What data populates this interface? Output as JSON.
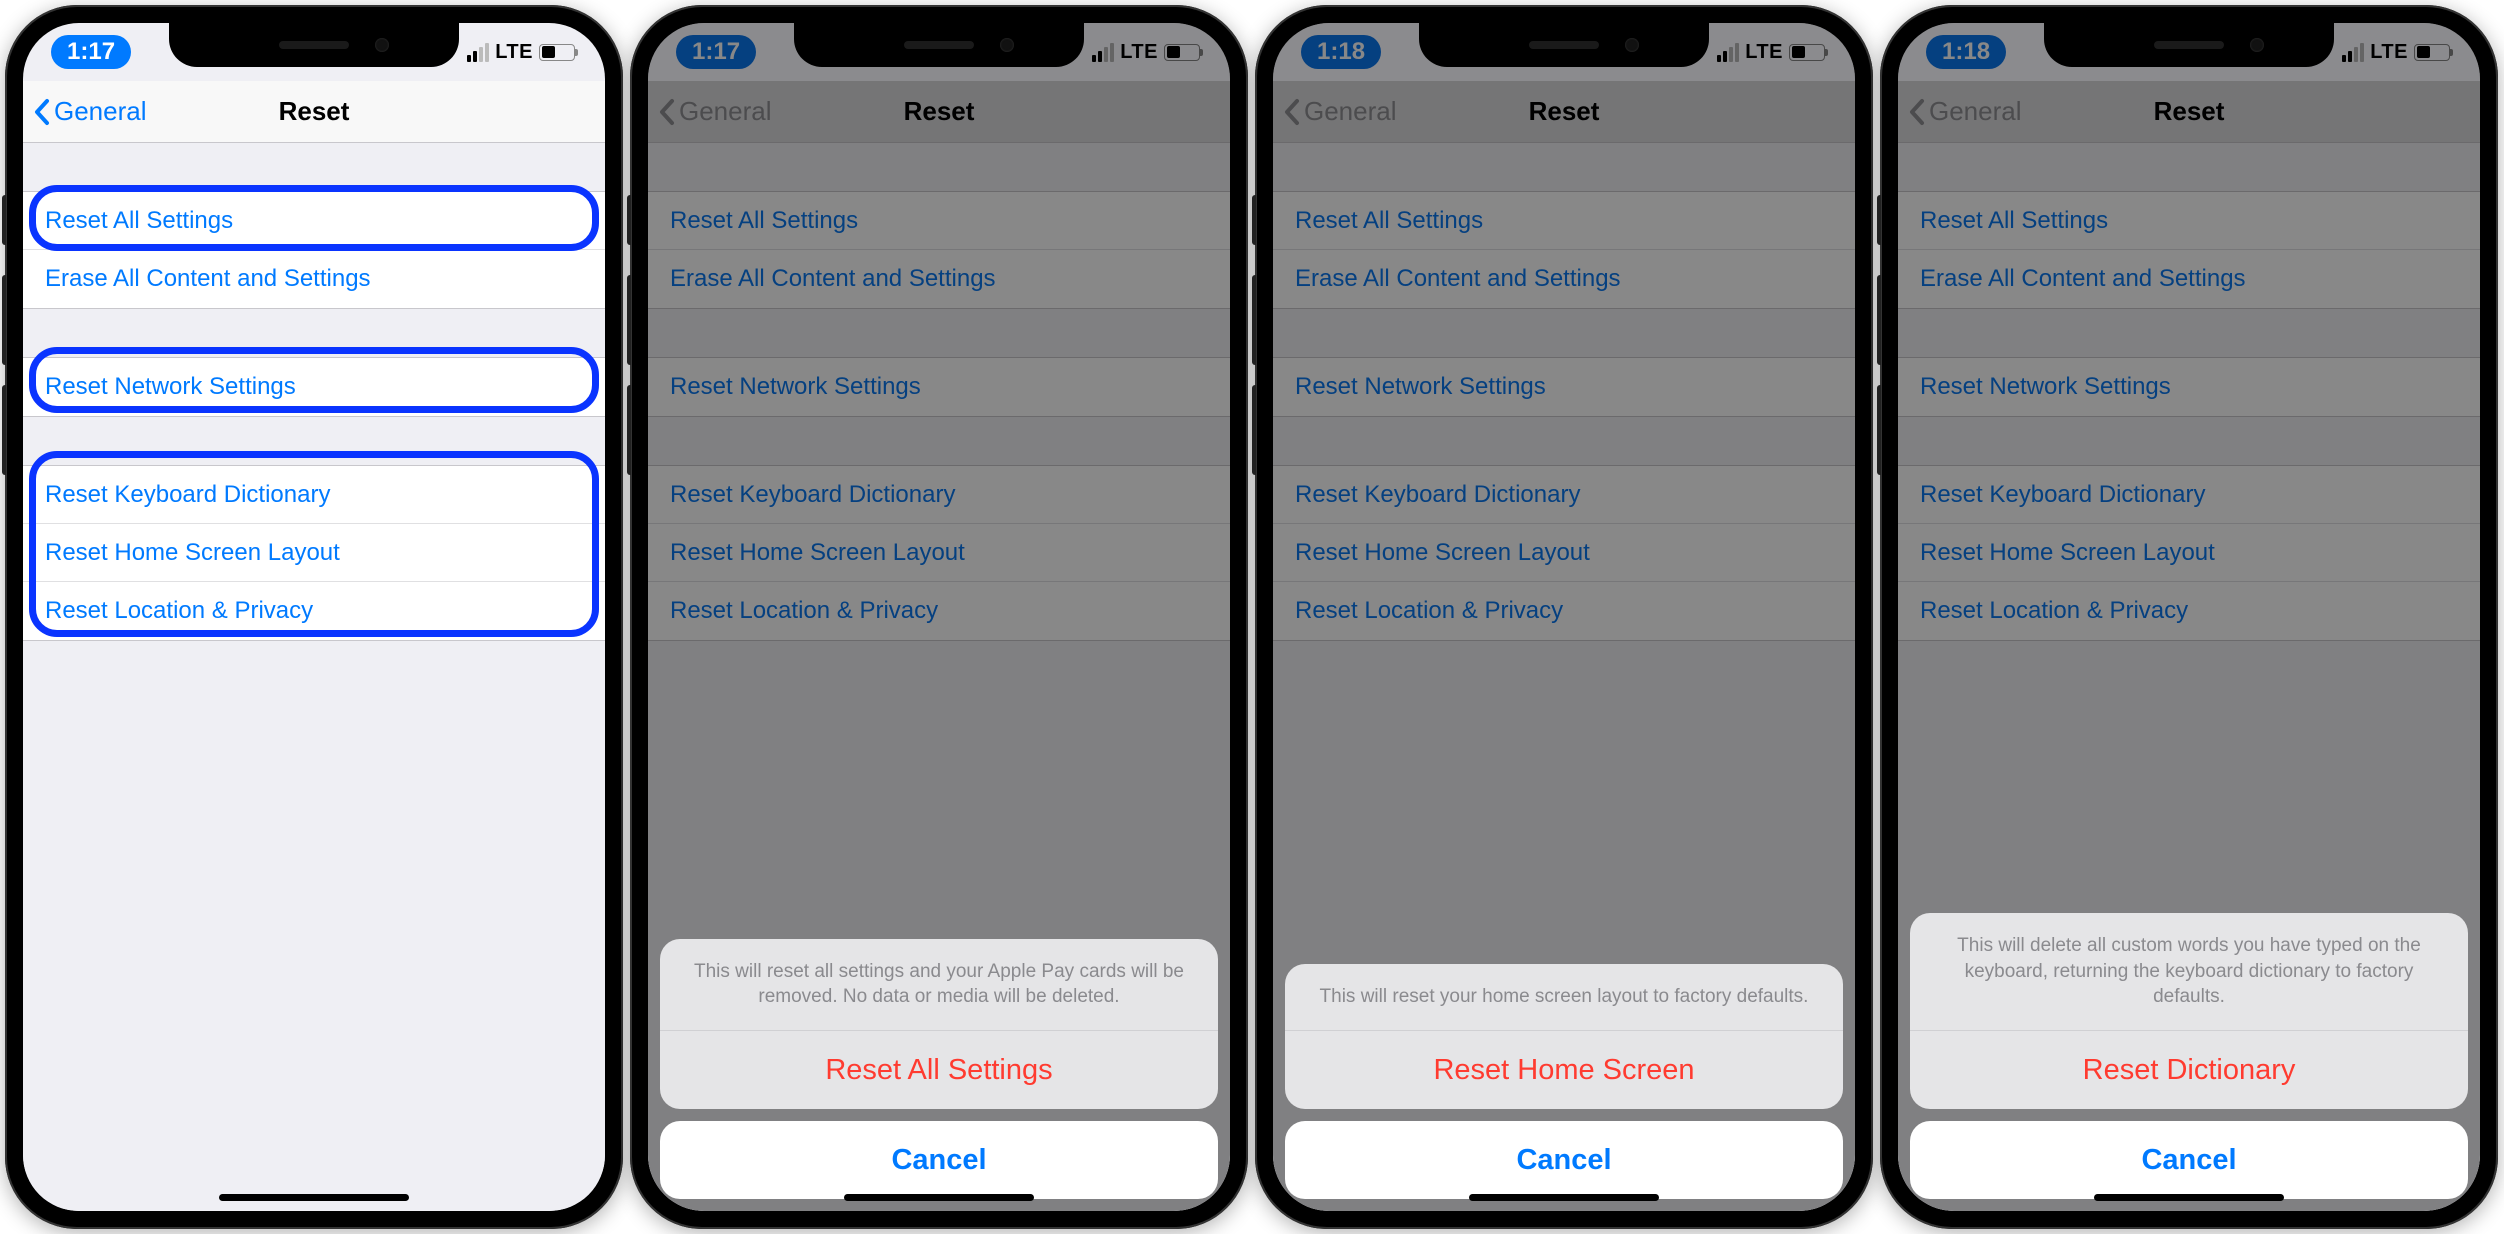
{
  "phones": [
    {
      "time": "1:17",
      "network_label": "LTE",
      "nav": {
        "back": "General",
        "title": "Reset"
      },
      "rows": {
        "reset_all": "Reset All Settings",
        "erase_all": "Erase All Content and Settings",
        "reset_network": "Reset Network Settings",
        "reset_keyboard": "Reset Keyboard Dictionary",
        "reset_home": "Reset Home Screen Layout",
        "reset_location": "Reset Location & Privacy"
      },
      "sheet": null
    },
    {
      "time": "1:17",
      "network_label": "LTE",
      "nav": {
        "back": "General",
        "title": "Reset"
      },
      "rows": {
        "reset_all": "Reset All Settings",
        "erase_all": "Erase All Content and Settings",
        "reset_network": "Reset Network Settings",
        "reset_keyboard": "Reset Keyboard Dictionary",
        "reset_home": "Reset Home Screen Layout",
        "reset_location": "Reset Location & Privacy"
      },
      "sheet": {
        "message": "This will reset all settings and your Apple Pay cards will be removed. No data or media will be deleted.",
        "action": "Reset All Settings",
        "cancel": "Cancel"
      }
    },
    {
      "time": "1:18",
      "network_label": "LTE",
      "nav": {
        "back": "General",
        "title": "Reset"
      },
      "rows": {
        "reset_all": "Reset All Settings",
        "erase_all": "Erase All Content and Settings",
        "reset_network": "Reset Network Settings",
        "reset_keyboard": "Reset Keyboard Dictionary",
        "reset_home": "Reset Home Screen Layout",
        "reset_location": "Reset Location & Privacy"
      },
      "sheet": {
        "message": "This will reset your home screen layout to factory defaults.",
        "action": "Reset Home Screen",
        "cancel": "Cancel"
      }
    },
    {
      "time": "1:18",
      "network_label": "LTE",
      "nav": {
        "back": "General",
        "title": "Reset"
      },
      "rows": {
        "reset_all": "Reset All Settings",
        "erase_all": "Erase All Content and Settings",
        "reset_network": "Reset Network Settings",
        "reset_keyboard": "Reset Keyboard Dictionary",
        "reset_home": "Reset Home Screen Layout",
        "reset_location": "Reset Location & Privacy"
      },
      "sheet": {
        "message": "This will delete all custom words you have typed on the keyboard, returning the keyboard dictionary to factory defaults.",
        "action": "Reset Dictionary",
        "cancel": "Cancel"
      }
    }
  ]
}
